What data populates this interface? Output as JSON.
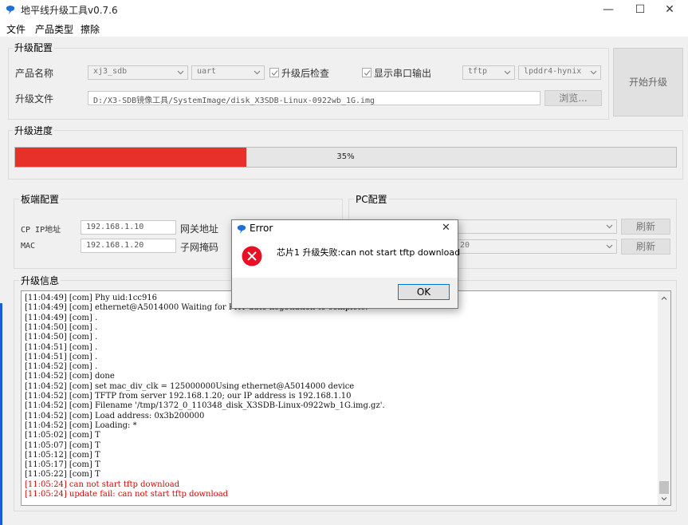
{
  "window": {
    "title": "地平线升级工具v0.7.6",
    "controls": {
      "minimize": "—",
      "maximize": "☐",
      "close": "✕"
    }
  },
  "menu": {
    "items": [
      "文件",
      "产品类型",
      "擦除"
    ]
  },
  "upgrade_config": {
    "title": "升级配置",
    "product_label": "产品名称",
    "product_value": "xj3_sdb",
    "interface_value": "uart",
    "verify_label": "升级后检查",
    "serial_output_label": "显示串口输出",
    "protocol_value": "tftp",
    "memory_value": "lpddr4-hynix",
    "file_label": "升级文件",
    "file_path": "D:/X3-SDB镜像工具/SystemImage/disk_X3SDB-Linux-0922wb_1G.img",
    "browse_label": "浏览...",
    "start_label": "开始升级"
  },
  "progress": {
    "title": "升级进度",
    "percent": 35,
    "text": "35%"
  },
  "board_config": {
    "title": "板端配置",
    "cp_ip_label": "CP IP地址",
    "cp_ip_value": "192.168.1.10",
    "gateway_label": "网关地址",
    "mac_label": "MAC",
    "mac_value": "192.168.1.20",
    "netmask_label": "子网掩码"
  },
  "pc_config": {
    "title": "PC配置",
    "ip_partial": "20",
    "refresh_label": "刷新"
  },
  "log": {
    "title": "升级信息",
    "lines": [
      {
        "text": "[11:04:49] [com] Phy uid:1cc916",
        "error": false
      },
      {
        "text": "[11:04:49] [com] ethernet@A5014000 Waiting for PHY auto negotiation to complete.",
        "error": false
      },
      {
        "text": "[11:04:49] [com] .",
        "error": false
      },
      {
        "text": "[11:04:50] [com] .",
        "error": false
      },
      {
        "text": "[11:04:50] [com] .",
        "error": false
      },
      {
        "text": "[11:04:51] [com] .",
        "error": false
      },
      {
        "text": "[11:04:51] [com] .",
        "error": false
      },
      {
        "text": "[11:04:52] [com] .",
        "error": false
      },
      {
        "text": "[11:04:52] [com]  done",
        "error": false
      },
      {
        "text": "[11:04:52] [com] set mac_div_clk = 125000000Using ethernet@A5014000 device",
        "error": false
      },
      {
        "text": "[11:04:52] [com] TFTP from server 192.168.1.20; our IP address is 192.168.1.10",
        "error": false
      },
      {
        "text": "[11:04:52] [com] Filename '/tmp/1372_0_110348_disk_X3SDB-Linux-0922wb_1G.img.gz'.",
        "error": false
      },
      {
        "text": "[11:04:52] [com] Load address: 0x3b200000",
        "error": false
      },
      {
        "text": "[11:04:52] [com] Loading: *",
        "error": false
      },
      {
        "text": "[11:05:02] [com] T",
        "error": false
      },
      {
        "text": "[11:05:07] [com] T",
        "error": false
      },
      {
        "text": "[11:05:12] [com] T",
        "error": false
      },
      {
        "text": "[11:05:17] [com] T",
        "error": false
      },
      {
        "text": "[11:05:22] [com] T",
        "error": false
      },
      {
        "text": "[11:05:24] can not start tftp download",
        "error": true
      },
      {
        "text": "[11:05:24] update fail: can not start tftp download",
        "error": true
      }
    ]
  },
  "dialog": {
    "title": "Error",
    "message": "芯片1 升级失败:can not start tftp download",
    "ok_label": "OK",
    "close": "✕"
  },
  "colors": {
    "progress_fill": "#e8302b",
    "error_text": "#e00000",
    "error_icon": "#e81123",
    "accent": "#0078d7"
  }
}
